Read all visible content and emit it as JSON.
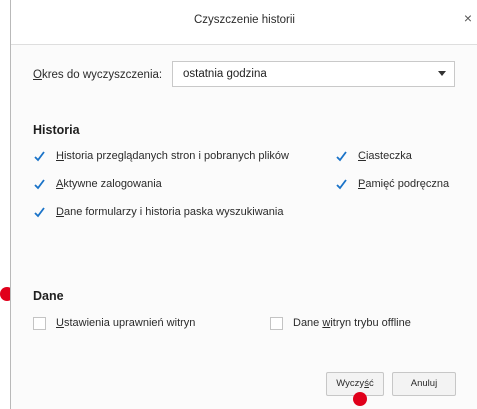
{
  "dialog": {
    "title": "Czyszczenie historii",
    "close_symbol": "×"
  },
  "time_range": {
    "label_accesskey": "O",
    "label_rest": "kres do wyczyszczenia:",
    "selected": "ostatnia godzina"
  },
  "history": {
    "heading": "Historia",
    "items": [
      {
        "accesskey": "H",
        "rest": "istoria przeglądanych stron i pobranych plików",
        "checked": true
      },
      {
        "accesskey": "C",
        "rest": "iasteczka",
        "checked": true
      },
      {
        "accesskey": "A",
        "rest": "ktywne zalogowania",
        "checked": true
      },
      {
        "accesskey": "P",
        "rest": "amięć podręczna",
        "checked": true
      },
      {
        "accesskey": "D",
        "rest": "ane formularzy i historia paska wyszukiwania",
        "checked": true
      }
    ]
  },
  "data": {
    "heading": "Dane",
    "items": [
      {
        "accesskey": "U",
        "rest": "stawienia uprawnień witryn",
        "checked": false
      },
      {
        "prefix": "Dane ",
        "accesskey": "w",
        "rest": "itryn trybu offline",
        "checked": false
      }
    ]
  },
  "buttons": {
    "clear_prefix": "Wyczy",
    "clear_accesskey": "ś",
    "clear_rest": "ć",
    "cancel": "Anuluj"
  },
  "colors": {
    "checkmark": "#1a73c8",
    "marker": "#e0001b"
  }
}
